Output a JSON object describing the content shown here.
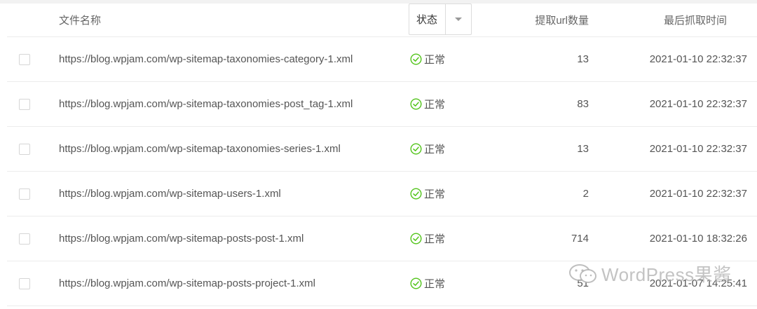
{
  "table": {
    "headers": {
      "name": "文件名称",
      "status": "状态",
      "count": "提取url数量",
      "time": "最后抓取时间"
    },
    "rows": [
      {
        "url": "https://blog.wpjam.com/wp-sitemap-taxonomies-category-1.xml",
        "status": "正常",
        "count": "13",
        "time": "2021-01-10 22:32:37"
      },
      {
        "url": "https://blog.wpjam.com/wp-sitemap-taxonomies-post_tag-1.xml",
        "status": "正常",
        "count": "83",
        "time": "2021-01-10 22:32:37"
      },
      {
        "url": "https://blog.wpjam.com/wp-sitemap-taxonomies-series-1.xml",
        "status": "正常",
        "count": "13",
        "time": "2021-01-10 22:32:37"
      },
      {
        "url": "https://blog.wpjam.com/wp-sitemap-users-1.xml",
        "status": "正常",
        "count": "2",
        "time": "2021-01-10 22:32:37"
      },
      {
        "url": "https://blog.wpjam.com/wp-sitemap-posts-post-1.xml",
        "status": "正常",
        "count": "714",
        "time": "2021-01-10 18:32:26"
      },
      {
        "url": "https://blog.wpjam.com/wp-sitemap-posts-project-1.xml",
        "status": "正常",
        "count": "51",
        "time": "2021-01-07 14:25:41"
      }
    ]
  },
  "watermark": "WordPress果酱",
  "colors": {
    "status_ok": "#52c41a",
    "border": "#ececec",
    "text": "#555555"
  },
  "icons": {
    "status_ok": "check-circle-icon",
    "filter": "caret-down-icon",
    "watermark": "wechat-icon"
  }
}
